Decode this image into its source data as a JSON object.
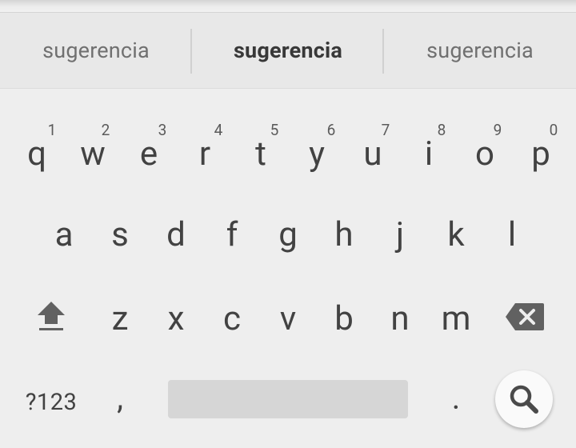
{
  "suggestions": [
    "sugerencia",
    "sugerencia",
    "sugerencia"
  ],
  "rows": [
    [
      "q",
      "w",
      "e",
      "r",
      "t",
      "y",
      "u",
      "i",
      "o",
      "p"
    ],
    [
      "a",
      "s",
      "d",
      "f",
      "g",
      "h",
      "j",
      "k",
      "l"
    ],
    [
      "z",
      "x",
      "c",
      "v",
      "b",
      "n",
      "m"
    ]
  ],
  "number_hints": [
    "1",
    "2",
    "3",
    "4",
    "5",
    "6",
    "7",
    "8",
    "9",
    "0"
  ],
  "bottom": {
    "symbols_label": "?123",
    "comma": ",",
    "period": "."
  },
  "icons": {
    "shift": "shift-arrow-icon",
    "backspace": "backspace-icon",
    "search": "search-icon"
  },
  "colors": {
    "background": "#eeeeee",
    "suggestion_bar": "#e8e8e8",
    "key_text": "#424242",
    "space_bar": "#d6d6d6",
    "search_button": "#fafafa"
  }
}
